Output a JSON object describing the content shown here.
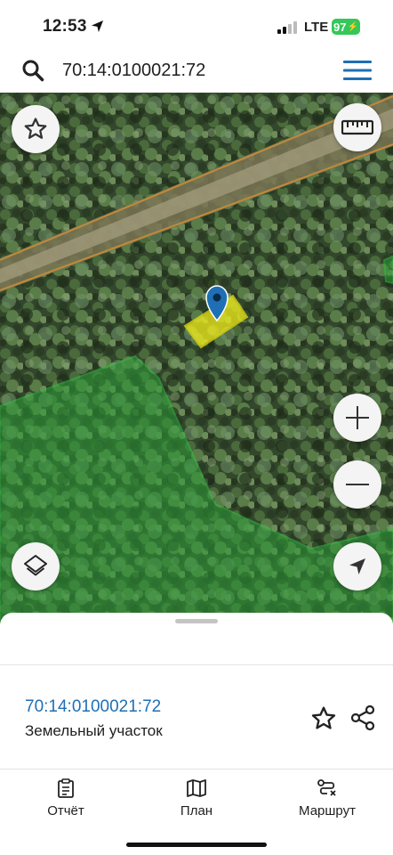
{
  "status_bar": {
    "time": "12:53",
    "network": "LTE",
    "battery": "97"
  },
  "search": {
    "query": "70:14:0100021:72"
  },
  "map": {
    "icons": [
      "star-icon",
      "ruler-icon",
      "zoom-in-icon",
      "zoom-out-icon",
      "layers-icon",
      "location-arrow-icon",
      "map-pin-icon"
    ]
  },
  "details": {
    "cadastral_number": "70:14:0100021:72",
    "object_type": "Земельный участок"
  },
  "tabs": [
    {
      "label": "Отчёт",
      "icon": "report-icon"
    },
    {
      "label": "План",
      "icon": "map-plan-icon"
    },
    {
      "label": "Маршрут",
      "icon": "route-icon"
    }
  ],
  "colors": {
    "accent": "#1f6fb5",
    "battery": "#34c759",
    "parcel_fill": "#f2ee1a",
    "forest_overlay": "#2e9e3a"
  }
}
